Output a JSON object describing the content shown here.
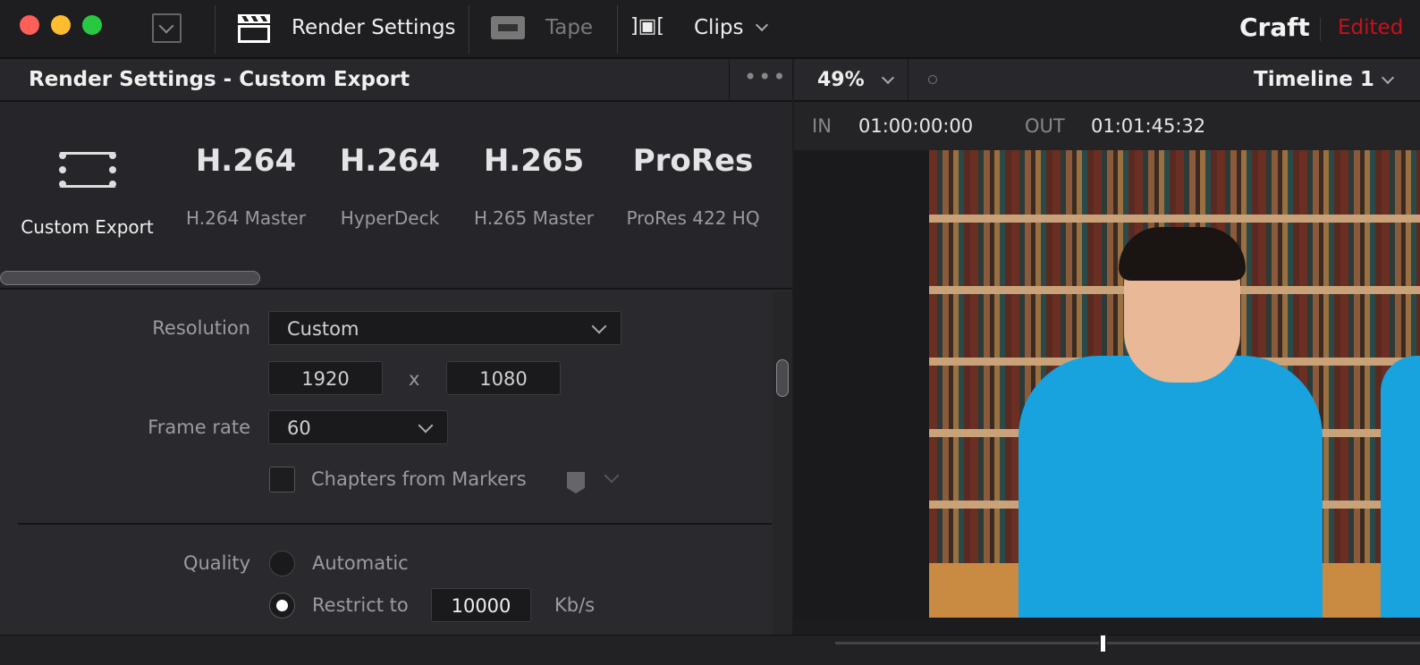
{
  "topbar": {
    "render_settings": "Render Settings",
    "tape": "Tape",
    "clips": "Clips",
    "page": "Craft",
    "status": "Edited"
  },
  "render": {
    "title": "Render Settings - Custom Export",
    "presets": [
      {
        "big": "",
        "label": "Custom Export"
      },
      {
        "big": "H.264",
        "label": "H.264 Master"
      },
      {
        "big": "H.264",
        "label": "HyperDeck"
      },
      {
        "big": "H.265",
        "label": "H.265 Master"
      },
      {
        "big": "ProRes",
        "label": "ProRes 422 HQ"
      }
    ],
    "resolution_label": "Resolution",
    "resolution": "Custom",
    "width": "1920",
    "x": "x",
    "height": "1080",
    "frame_rate_label": "Frame rate",
    "frame_rate": "60",
    "chapters_label": "Chapters from Markers",
    "chapters_checked": false,
    "quality_label": "Quality",
    "automatic": "Automatic",
    "restrict": "Restrict to",
    "bitrate": "10000",
    "unit": "Kb/s",
    "selected_quality": "restrict"
  },
  "viewer": {
    "zoom": "49%",
    "timeline": "Timeline 1",
    "in_label": "IN",
    "in": "01:00:00:00",
    "out_label": "OUT",
    "out": "01:01:45:32"
  },
  "colors": {
    "close": "#fe5f57",
    "min": "#febc2e",
    "max": "#28c840",
    "edited": "#c8101a"
  }
}
